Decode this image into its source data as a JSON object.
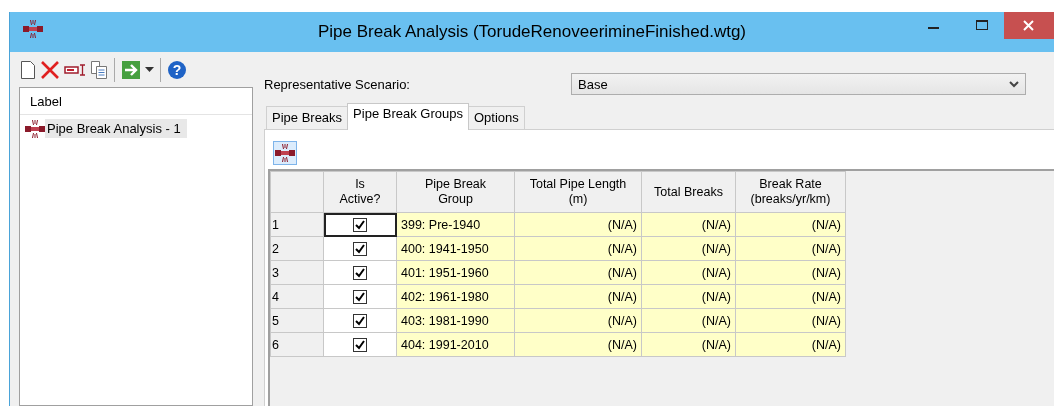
{
  "window": {
    "title": "Pipe Break Analysis (TorudeRenoveerimineFinished.wtg)"
  },
  "toolbar": {
    "help_glyph": "?"
  },
  "left_panel": {
    "column_header": "Label",
    "items": [
      {
        "label": "Pipe Break Analysis - 1",
        "selected": true
      }
    ]
  },
  "scenario": {
    "label": "Representative Scenario:",
    "value": "Base"
  },
  "tabs": [
    {
      "label": "Pipe Breaks",
      "selected": false
    },
    {
      "label": "Pipe Break Groups",
      "selected": true
    },
    {
      "label": "Options",
      "selected": false
    }
  ],
  "grid": {
    "columns": [
      "Is\nActive?",
      "Pipe Break\nGroup",
      "Total Pipe Length\n(m)",
      "Total Breaks",
      "Break Rate\n(breaks/yr/km)"
    ],
    "rows": [
      {
        "number": "1",
        "active": true,
        "focused": true,
        "group": "399: Pre-1940",
        "length": "(N/A)",
        "breaks": "(N/A)",
        "rate": "(N/A)"
      },
      {
        "number": "2",
        "active": true,
        "focused": false,
        "group": "400: 1941-1950",
        "length": "(N/A)",
        "breaks": "(N/A)",
        "rate": "(N/A)"
      },
      {
        "number": "3",
        "active": true,
        "focused": false,
        "group": "401: 1951-1960",
        "length": "(N/A)",
        "breaks": "(N/A)",
        "rate": "(N/A)"
      },
      {
        "number": "4",
        "active": true,
        "focused": false,
        "group": "402: 1961-1980",
        "length": "(N/A)",
        "breaks": "(N/A)",
        "rate": "(N/A)"
      },
      {
        "number": "5",
        "active": true,
        "focused": false,
        "group": "403: 1981-1990",
        "length": "(N/A)",
        "breaks": "(N/A)",
        "rate": "(N/A)"
      },
      {
        "number": "6",
        "active": true,
        "focused": false,
        "group": "404: 1991-2010",
        "length": "(N/A)",
        "breaks": "(N/A)",
        "rate": "(N/A)"
      }
    ]
  }
}
